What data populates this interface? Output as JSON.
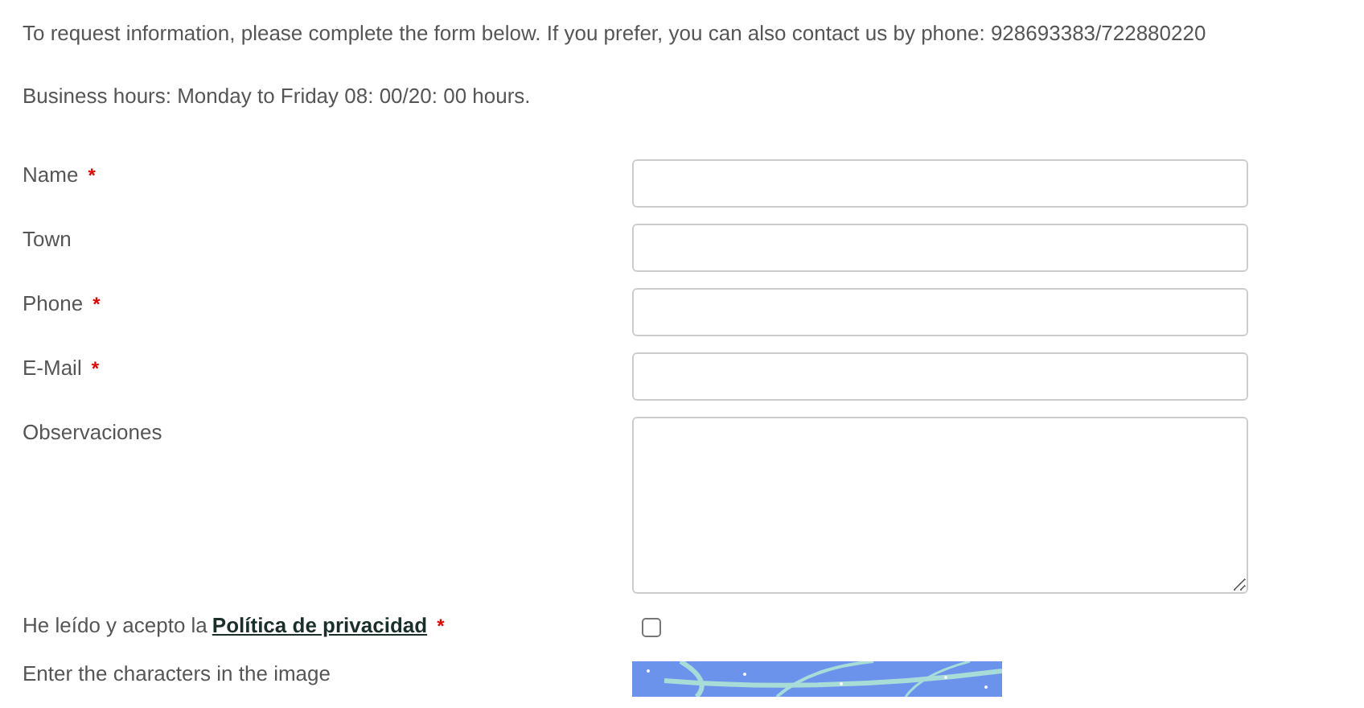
{
  "intro": [
    "To request information, please complete the form below. If you prefer, you can also contact us by phone: 928693383/722880220",
    "Business hours: Monday to Friday 08: 00/20: 00 hours."
  ],
  "fields": [
    {
      "kind": "text",
      "label": "Name",
      "required_mark": "*"
    },
    {
      "kind": "text",
      "label": "Town"
    },
    {
      "kind": "text",
      "label": "Phone",
      "required_mark": "*"
    },
    {
      "kind": "text",
      "label": "E-Mail",
      "required_mark": "*"
    },
    {
      "kind": "textarea",
      "label": "Observaciones"
    },
    {
      "kind": "checkbox",
      "label": "He leído y acepto la",
      "link": "Política de privacidad",
      "required_mark": "*",
      "checked": false
    },
    {
      "kind": "captcha",
      "label": "Enter the characters in the image"
    }
  ]
}
